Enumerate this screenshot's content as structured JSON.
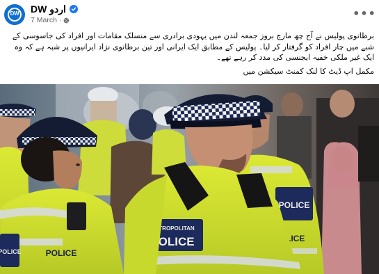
{
  "post": {
    "page_name": "DW اردو",
    "date": "7 March",
    "meta_separator": "·",
    "verified_icon": "verified-badge-icon",
    "privacy_icon": "globe-icon",
    "more_icon": "more-options-icon",
    "text_paragraph_1": "برطانوی پولیس نے آج چھ مارچ بروز جمعہ لندن میں یہودی برادری سے منسلک مقامات اور افراد کی جاسوسی کے شبے میں چار افراد کو گرفتار کر لیا۔ پولیس کے مطابق ایک ایرانی اور تین برطانوی نژاد ایرانیوں پر شبہ ہے کہ وہ ایک غیر ملکی خفیہ ایجنسی کی مدد کر رہے تھے۔",
    "text_paragraph_2": "مکمل اپ ڈیٹ کا لنک کمنٹ سیکشن میں",
    "avatar_text": "DW"
  },
  "image": {
    "vest_label_1": "POLICE",
    "vest_label_2": "METROPOLITAN",
    "vest_label_3": "POLICE",
    "vest_label_4": "POLICE",
    "vest_label_5": "POLICE",
    "vest_label_6": "POLICE"
  },
  "colors": {
    "accent": "#1877f2",
    "hi_vis": "#d4e62c",
    "navy": "#17213c"
  }
}
